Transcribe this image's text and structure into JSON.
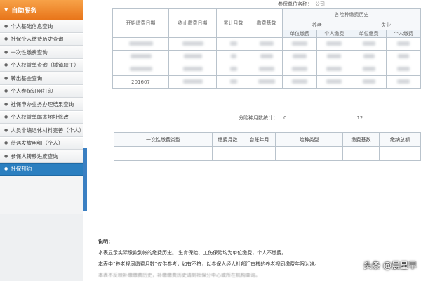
{
  "sidebar": {
    "header": "自助服务",
    "items": [
      {
        "label": "个人基础信息查询"
      },
      {
        "label": "社保个人缴费历史查询"
      },
      {
        "label": "一次性缴费查询"
      },
      {
        "label": "个人权益单查询（城镇职工）"
      },
      {
        "label": "转出基金查询"
      },
      {
        "label": "个人参保证明打印"
      },
      {
        "label": "社保申办业务办理结果查询"
      },
      {
        "label": "个人权益单邮寄地址修改"
      },
      {
        "label": "人员非编退休材料完善（个人）"
      },
      {
        "label": "待遇发放明细（个人）"
      },
      {
        "label": "参保人转移进度查询"
      },
      {
        "label": "社保预约",
        "active": true
      }
    ]
  },
  "top": {
    "unit_label": "参保单位名称：",
    "unit_value": "公司"
  },
  "history_table": {
    "group_header": "各险种缴费历史",
    "columns": [
      "开始缴费日期",
      "终止缴费日期",
      "累计月数",
      "缴费基数"
    ],
    "insurance_groups": [
      "养老",
      "失业"
    ],
    "sub_columns": [
      "单位缴费",
      "个人缴费",
      "单位缴费",
      "个人缴费"
    ],
    "last_row_start": "201607"
  },
  "summary": {
    "label": "分险种月数统计：",
    "value1": "0",
    "value2": "12"
  },
  "lump_table": {
    "columns": [
      "一次性缴费类型",
      "缴费月数",
      "台账年月",
      "险种类型",
      "缴费基数",
      "缴纳总额"
    ]
  },
  "notes": {
    "title": "说明：",
    "line1": "本表显示实际缴款到帐的缴费历史。 生育保险、工伤保险均为单位缴费，个人不缴费。",
    "line2": "本表中“养老视同缴费月数”仅供参考，如有不符，以参保人经人社部门审核的养老视同缴费年限为准。",
    "line3": "本表不反映补缴缴费历史，补缴缴费历史请到社保分中心或所在机构查询。"
  },
  "watermark": {
    "source": "头条",
    "author": "@晨星早"
  }
}
